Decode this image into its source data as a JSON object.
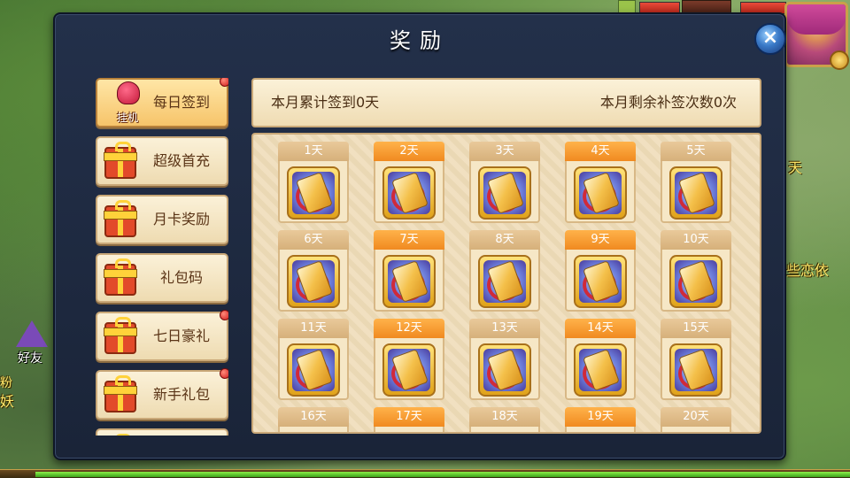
{
  "dialog": {
    "title": "奖励",
    "close_icon": "×"
  },
  "summary": {
    "left": "本月累计签到0天",
    "right": "本月剩余补签次数0次"
  },
  "menu": [
    {
      "label": "每日签到",
      "icon": "octopus-icon",
      "tag": "挂机",
      "active": true,
      "badge": true
    },
    {
      "label": "超级首充",
      "icon": "gift-box-icon",
      "active": false,
      "badge": false
    },
    {
      "label": "月卡奖励",
      "icon": "gift-box-icon",
      "active": false,
      "badge": false
    },
    {
      "label": "礼包码",
      "icon": "gift-box-icon",
      "active": false,
      "badge": false
    },
    {
      "label": "七日豪礼",
      "icon": "gift-box-icon",
      "active": false,
      "badge": true
    },
    {
      "label": "新手礼包",
      "icon": "gift-box-icon",
      "active": false,
      "badge": true
    },
    {
      "label": "",
      "icon": "gift-box-icon",
      "active": false,
      "badge": false
    }
  ],
  "days": [
    "1天",
    "2天",
    "3天",
    "4天",
    "5天",
    "6天",
    "7天",
    "8天",
    "9天",
    "10天",
    "11天",
    "12天",
    "13天",
    "14天",
    "15天",
    "16天",
    "17天",
    "18天",
    "19天",
    "20天"
  ],
  "reward_icon": "scroll-reward-icon",
  "background": {
    "friend_label": "好友",
    "npc_name_1": "天",
    "npc_name_2": "些恋依",
    "npc_name_3": "妖",
    "npc_name_4": "粉"
  },
  "colors": {
    "dialog_bg": "#1a2438",
    "tab_active": "#f6c46a",
    "day_header_orange": "#f08a20",
    "day_header_tan": "#d6b07a",
    "badge_red": "#d01a1a"
  }
}
